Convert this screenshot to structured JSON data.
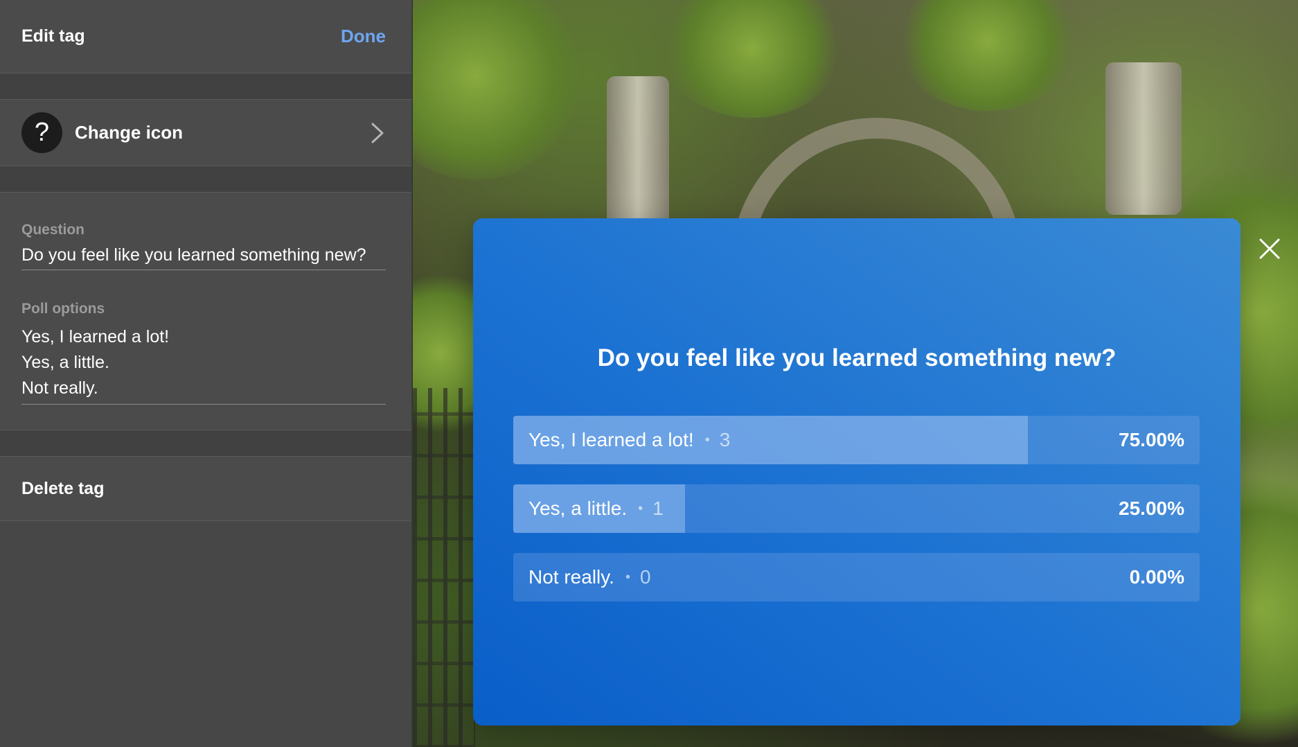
{
  "panel": {
    "title": "Edit tag",
    "done_label": "Done",
    "change_icon_label": "Change icon",
    "icon_glyph": "?",
    "question_label": "Question",
    "question_value": "Do you feel like you learned something new?",
    "poll_options_label": "Poll options",
    "poll_options": [
      "Yes, I learned a lot!",
      "Yes, a little.",
      "Not really."
    ],
    "delete_label": "Delete tag"
  },
  "poll": {
    "question": "Do you feel like you learned something new?",
    "bullet": "•",
    "options": [
      {
        "label": "Yes, I learned a lot!",
        "count": "3",
        "percent_text": "75.00%",
        "fraction": 0.75
      },
      {
        "label": "Yes, a little.",
        "count": "1",
        "percent_text": "25.00%",
        "fraction": 0.25
      },
      {
        "label": "Not really.",
        "count": "0",
        "percent_text": "0.00%",
        "fraction": 0.0
      }
    ]
  },
  "icons": {
    "chevron": "chevron-right-icon",
    "close": "close-icon",
    "question_mark": "question-mark-icon"
  },
  "colors": {
    "panel_bg": "#4b4b4b",
    "accent": "#6fa6f0",
    "card_blue": "#1c72d2"
  }
}
